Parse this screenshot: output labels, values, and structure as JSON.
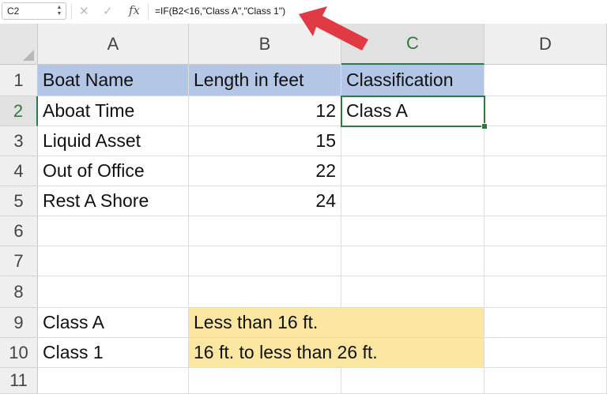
{
  "formula_bar": {
    "name_box": "C2",
    "cancel_icon": "✕",
    "enter_icon": "✓",
    "fx_label": "fx",
    "formula": "=IF(B2<16,\"Class A\",\"Class 1\")"
  },
  "columns": [
    "A",
    "B",
    "C",
    "D"
  ],
  "rows": [
    "1",
    "2",
    "3",
    "4",
    "5",
    "6",
    "7",
    "8",
    "9",
    "10",
    "11"
  ],
  "cells": {
    "A1": "Boat Name",
    "B1": "Length in feet",
    "C1": "Classification",
    "A2": "Aboat Time",
    "B2": "12",
    "C2": "Class A",
    "A3": "Liquid Asset",
    "B3": "15",
    "A4": "Out of Office",
    "B4": "22",
    "A5": "Rest A Shore",
    "B5": "24",
    "A9": "Class A",
    "B9": "Less than 16 ft.",
    "A10": "Class 1",
    "B10": "16 ft. to less than 26 ft."
  },
  "colors": {
    "header_fill": "#b4c6e6",
    "legend_fill": "#fbe6a2",
    "selection": "#2b7a3e",
    "arrow": "#e03a45"
  }
}
